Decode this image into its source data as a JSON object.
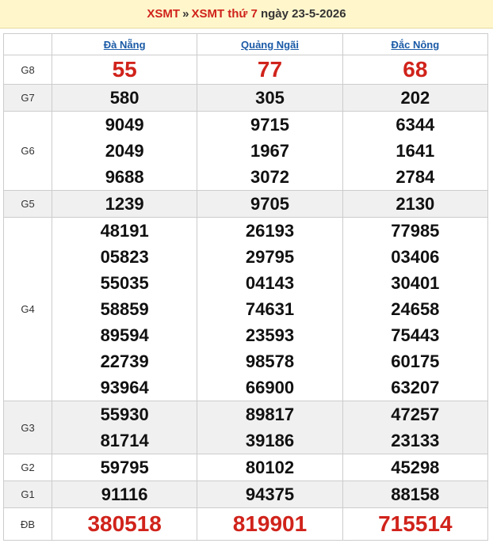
{
  "header": {
    "link1": "XSMT",
    "separator": "»",
    "link2": "XSMT thứ 7",
    "date_text": "ngày 23-5-2026"
  },
  "provinces": [
    "Đà Nẵng",
    "Quảng Ngãi",
    "Đắc Nông"
  ],
  "colors": {
    "accent_red": "#d0231b",
    "link_blue": "#1a5aa6",
    "header_bg": "#fff6cc"
  },
  "rows": [
    {
      "label": "G8",
      "cells": [
        [
          "55"
        ],
        [
          "77"
        ],
        [
          "68"
        ]
      ]
    },
    {
      "label": "G7",
      "cells": [
        [
          "580"
        ],
        [
          "305"
        ],
        [
          "202"
        ]
      ]
    },
    {
      "label": "G6",
      "cells": [
        [
          "9049",
          "2049",
          "9688"
        ],
        [
          "9715",
          "1967",
          "3072"
        ],
        [
          "6344",
          "1641",
          "2784"
        ]
      ]
    },
    {
      "label": "G5",
      "cells": [
        [
          "1239"
        ],
        [
          "9705"
        ],
        [
          "2130"
        ]
      ]
    },
    {
      "label": "G4",
      "cells": [
        [
          "48191",
          "05823",
          "55035",
          "58859",
          "89594",
          "22739",
          "93964"
        ],
        [
          "26193",
          "29795",
          "04143",
          "74631",
          "23593",
          "98578",
          "66900"
        ],
        [
          "77985",
          "03406",
          "30401",
          "24658",
          "75443",
          "60175",
          "63207"
        ]
      ]
    },
    {
      "label": "G3",
      "cells": [
        [
          "55930",
          "81714"
        ],
        [
          "89817",
          "39186"
        ],
        [
          "47257",
          "23133"
        ]
      ]
    },
    {
      "label": "G2",
      "cells": [
        [
          "59795"
        ],
        [
          "80102"
        ],
        [
          "45298"
        ]
      ]
    },
    {
      "label": "G1",
      "cells": [
        [
          "91116"
        ],
        [
          "94375"
        ],
        [
          "88158"
        ]
      ]
    },
    {
      "label": "ĐB",
      "cells": [
        [
          "380518"
        ],
        [
          "819901"
        ],
        [
          "715514"
        ]
      ]
    }
  ]
}
